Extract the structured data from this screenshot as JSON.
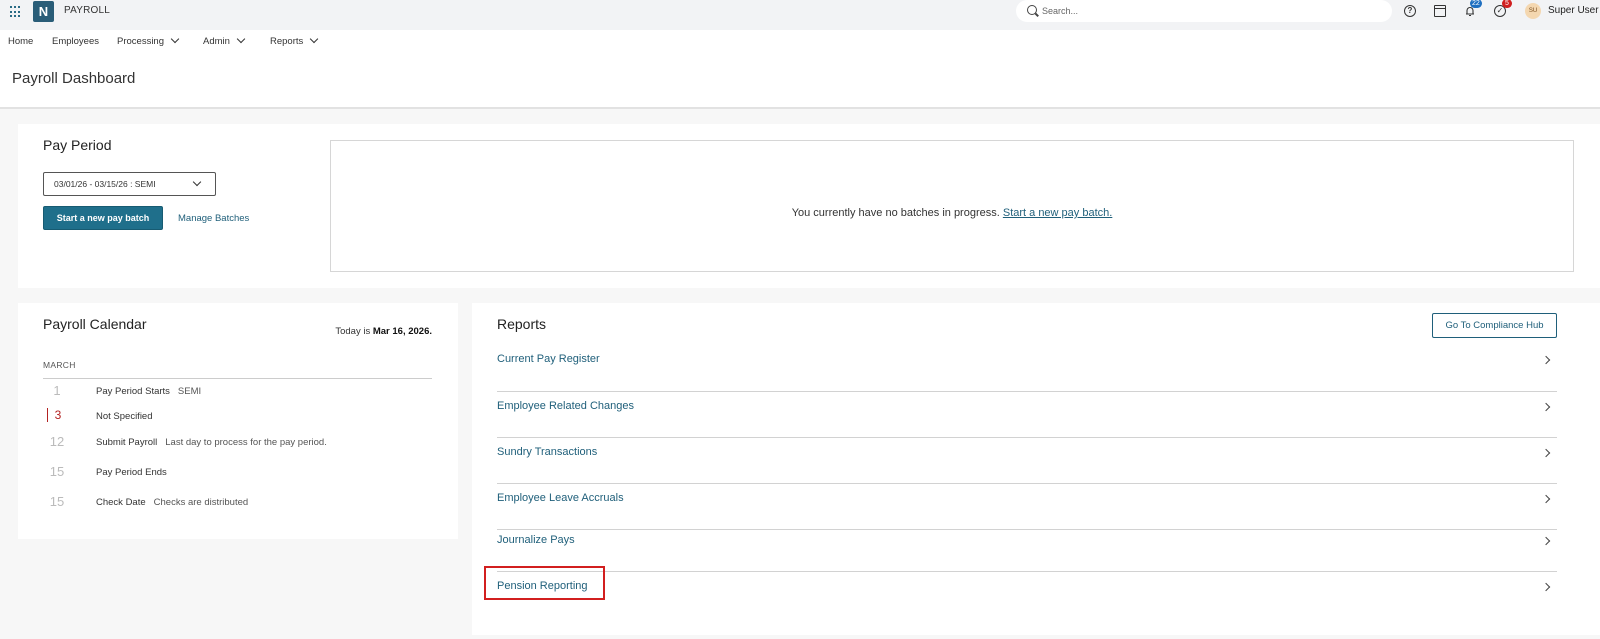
{
  "topbar": {
    "app_name": "PAYROLL",
    "logo_letter": "N",
    "search_placeholder": "Search...",
    "notification_count": "22",
    "task_count": "5",
    "avatar_initials": "SU",
    "user_name": "Super User",
    "icons": [
      "apps-grid-icon",
      "search-icon",
      "help-icon",
      "calendar-icon",
      "bell-icon",
      "check-circle-icon"
    ]
  },
  "nav": {
    "home": "Home",
    "employees": "Employees",
    "processing": "Processing",
    "admin": "Admin",
    "reports": "Reports"
  },
  "page": {
    "title": "Payroll Dashboard"
  },
  "pay_period": {
    "heading": "Pay Period",
    "selected_period": "03/01/26 - 03/15/26 : SEMI",
    "start_button": "Start a new pay batch",
    "manage_link": "Manage Batches",
    "empty_message": "You currently have no batches in progress.",
    "empty_link": "Start a new pay batch."
  },
  "calendar": {
    "heading": "Payroll Calendar",
    "today_prefix": "Today is",
    "today_date": "Mar 16, 2026.",
    "month": "MARCH",
    "events": [
      {
        "day": "1",
        "label": "Pay Period Starts",
        "note": "SEMI"
      },
      {
        "day": "3",
        "label": "Not Specified",
        "note": ""
      },
      {
        "day": "12",
        "label": "Submit Payroll",
        "note": "Last day to process for the pay period."
      },
      {
        "day": "15",
        "label": "Pay Period Ends",
        "note": ""
      },
      {
        "day": "15",
        "label": "Check Date",
        "note": "Checks are distributed"
      }
    ]
  },
  "reports": {
    "heading": "Reports",
    "compliance_button": "Go To Compliance Hub",
    "items": [
      "Current Pay Register",
      "Employee Related Changes",
      "Sundry Transactions",
      "Employee Leave Accruals",
      "Journalize Pays",
      "Pension Reporting"
    ],
    "highlighted_item": "Pension Reporting",
    "highlight_color": "#d21f1f"
  }
}
